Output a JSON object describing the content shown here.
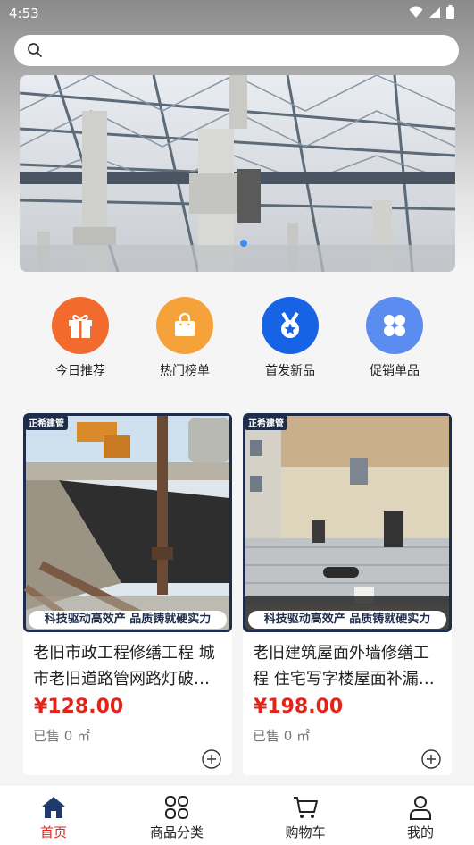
{
  "status_bar": {
    "time": "4:53"
  },
  "search": {
    "placeholder": ""
  },
  "quick_entries": [
    {
      "label": "今日推荐",
      "icon": "gift-icon",
      "color": "#f26a2e"
    },
    {
      "label": "热门榜单",
      "icon": "shopping-bag-icon",
      "color": "#f5a23a"
    },
    {
      "label": "首发新品",
      "icon": "medal-icon",
      "color": "#1763e6"
    },
    {
      "label": "促销单品",
      "icon": "grid-icon",
      "color": "#5b8cf0"
    }
  ],
  "products": [
    {
      "tag": "正希建管",
      "slogan": "科技驱动高效产 品质铸就硬实力",
      "title": "老旧市政工程修缮工程 城市老旧道路管网路灯破…",
      "price": "¥128.00",
      "sold": "已售 0 ㎡"
    },
    {
      "tag": "正希建管",
      "slogan": "科技驱动高效产 品质铸就硬实力",
      "title": "老旧建筑屋面外墙修缮工程 住宅写字楼屋面补漏…",
      "price": "¥198.00",
      "sold": "已售 0 ㎡"
    }
  ],
  "tabs": [
    {
      "label": "首页",
      "icon": "home-icon",
      "active": true
    },
    {
      "label": "商品分类",
      "icon": "category-grid-icon",
      "active": false
    },
    {
      "label": "购物车",
      "icon": "cart-icon",
      "active": false
    },
    {
      "label": "我的",
      "icon": "user-icon",
      "active": false
    }
  ],
  "colors": {
    "accent": "#e1251b",
    "tag_bg": "#1f2d4a"
  }
}
